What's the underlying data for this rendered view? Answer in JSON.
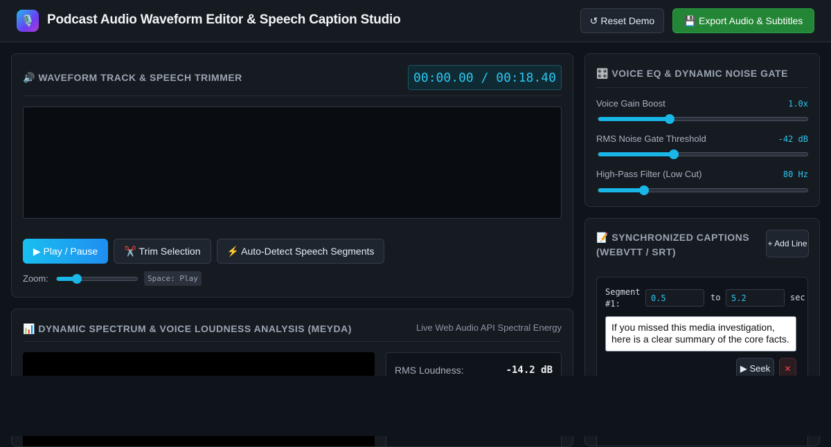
{
  "header": {
    "logo_icon": "microphone-icon",
    "title": "Podcast Audio Waveform Editor & Speech Caption Studio",
    "reset_label": "↺ Reset Demo",
    "export_label": "💾 Export Audio & Subtitles"
  },
  "waveform": {
    "title": "🔊 Waveform Track & Speech Trimmer",
    "timecode": "00:00.00 / 00:18.40",
    "play_label": "▶ Play / Pause",
    "trim_label": "✂️ Trim Selection",
    "detect_label": "⚡ Auto-Detect Speech Segments",
    "zoom_label": "Zoom:",
    "zoom_level": 0.25,
    "shortcut_hint": "Space: Play"
  },
  "spectrum": {
    "title": "📊 Dynamic Spectrum & Voice Loudness Analysis (Meyda)",
    "subtitle": "Live Web Audio API Spectral Energy",
    "rms_label": "RMS Loudness:",
    "rms_value": "-14.2 dB"
  },
  "eq": {
    "title": "🎛️ Voice EQ & Dynamic Noise Gate",
    "gain_label": "Voice Gain Boost",
    "gain_value": "1.0x",
    "gain_level": 0.34,
    "gate_label": "RMS Noise Gate Threshold",
    "gate_value": "-42 dB",
    "gate_level": 0.36,
    "hpf_label": "High-Pass Filter (Low Cut)",
    "hpf_value": "80 Hz",
    "hpf_level": 0.22
  },
  "captions": {
    "title": "📝 Synchronized Captions (WebVTT / SRT)",
    "add_label": "+ Add Line",
    "segments": [
      {
        "label": "Segment #1:",
        "start": "0.5",
        "to_label": "to",
        "end": "5.2",
        "unit_label": "sec",
        "text": "If you missed this media investigation, here is a clear summary of the core facts.",
        "seek_label": "▶ Seek",
        "delete_label": "✕"
      }
    ]
  },
  "colors": {
    "accent": "#19b7e8",
    "export_green": "#238636",
    "background": "#0f131a",
    "panel": "#161b22"
  }
}
